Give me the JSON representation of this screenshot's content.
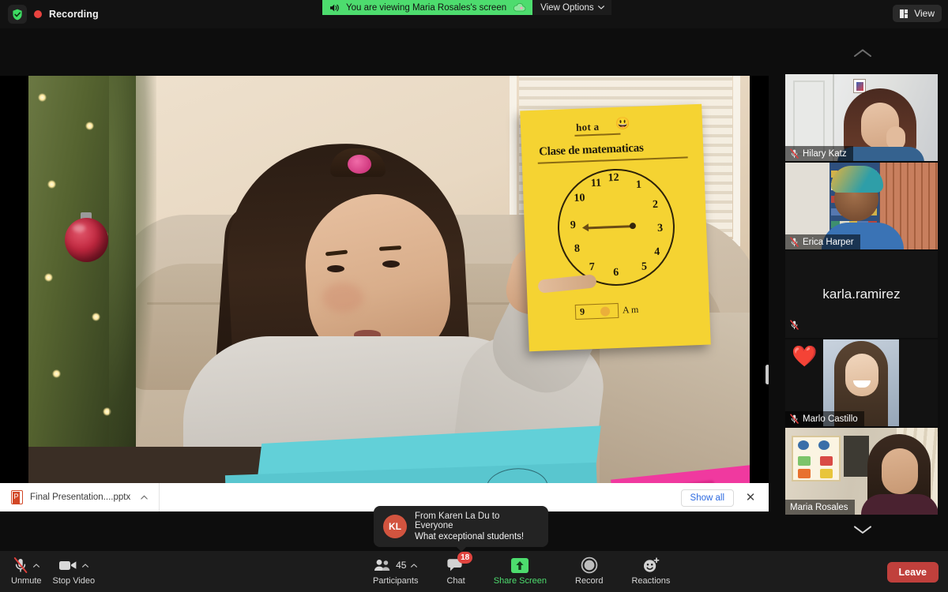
{
  "topbar": {
    "shield_icon": "shield-check-icon",
    "recording_label": "Recording",
    "viewing_banner": {
      "speaker_icon": "speaker-icon",
      "text": "You are viewing Maria Rosales's screen",
      "cloud_icon": "cloud-icon",
      "view_options_label": "View Options",
      "chevron_icon": "chevron-down-icon"
    },
    "view_button": {
      "label": "View",
      "icon": "layout-grid-icon"
    }
  },
  "share": {
    "scroll_up_icon": "chevron-up-icon",
    "scroll_down_icon": "chevron-down-icon",
    "poster": {
      "title": "hot a",
      "emoji": "😃",
      "subtitle": "Clase de matematicas",
      "clock_numbers": [
        "12",
        "1",
        "2",
        "3",
        "4",
        "5",
        "6",
        "7",
        "8",
        "9",
        "10",
        "11"
      ],
      "time_box": "9",
      "am_label": "A m"
    }
  },
  "filebar": {
    "file_icon": "powerpoint-file-icon",
    "file_name": "Final Presentation....pptx",
    "chevron_icon": "chevron-up-icon",
    "show_all_label": "Show all",
    "close_icon": "close-icon"
  },
  "chat_toast": {
    "avatar_initials": "KL",
    "from_line": "From Karen La Du to Everyone",
    "message": "What exceptional students!"
  },
  "participants": [
    {
      "name": "Hilary Katz",
      "muted": true,
      "label_position": "bar",
      "active": false,
      "heart": false
    },
    {
      "name": "Erica Harper",
      "muted": true,
      "label_position": "bar",
      "active": false,
      "heart": false
    },
    {
      "name": "karla.ramirez",
      "muted": true,
      "label_position": "center",
      "active": false,
      "heart": false
    },
    {
      "name": "Marlo Castillo",
      "muted": true,
      "label_position": "bar",
      "active": false,
      "heart": true
    },
    {
      "name": "Maria Rosales",
      "muted": false,
      "label_position": "bar",
      "active": true,
      "heart": false
    }
  ],
  "toolbar": {
    "mic": {
      "label": "Unmute",
      "icon": "microphone-muted-icon",
      "caret": "chevron-up-icon"
    },
    "video": {
      "label": "Stop Video",
      "icon": "video-camera-icon",
      "caret": "chevron-up-icon"
    },
    "participants": {
      "label": "Participants",
      "count": "45",
      "icon": "people-icon",
      "caret": "chevron-up-icon"
    },
    "chat": {
      "label": "Chat",
      "badge": "18",
      "icon": "chat-bubble-icon"
    },
    "share": {
      "label": "Share Screen",
      "icon": "share-arrow-up-icon"
    },
    "record": {
      "label": "Record",
      "icon": "record-circle-icon"
    },
    "reactions": {
      "label": "Reactions",
      "icon": "smiley-plus-icon"
    },
    "leave": {
      "label": "Leave"
    }
  },
  "colors": {
    "banner_green": "#4ddc6e",
    "record_red": "#e8433f",
    "leave_red": "#c0403c",
    "badge_red": "#e0443f",
    "active_border": "#e6e86a",
    "link_blue": "#2d6ae0"
  }
}
